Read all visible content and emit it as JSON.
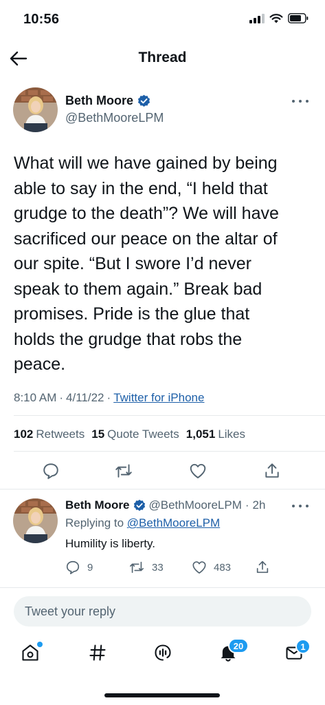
{
  "status_bar": {
    "time": "10:56"
  },
  "header": {
    "title": "Thread"
  },
  "main_tweet": {
    "name": "Beth Moore",
    "handle": "@BethMooreLPM",
    "text": "What will we have gained by being\nable to say in the end, “I held that\ngrudge to the death”? We will have\nsacrificed our peace on the altar of\nour spite. “But I swore I’d never\nspeak to them again.” Break bad\npromises. Pride is the glue that\nholds the grudge that robs the\npeace.",
    "time": "8:10 AM",
    "sep1": "·",
    "date": "4/11/22",
    "sep2": "·",
    "source": "Twitter for iPhone",
    "retweets_count": "102",
    "retweets_label": "Retweets",
    "quotes_count": "15",
    "quotes_label": "Quote Tweets",
    "likes_count": "1,051",
    "likes_label": "Likes"
  },
  "reply": {
    "name": "Beth Moore",
    "handle": "@BethMooreLPM",
    "sep": "·",
    "age": "2h",
    "replying_prefix": "Replying to",
    "replying_to": "@BethMooreLPM",
    "text": "Humility is liberty.",
    "reply_count": "9",
    "retweet_count": "33",
    "like_count": "483"
  },
  "compose": {
    "placeholder": "Tweet your reply"
  },
  "tab_bar": {
    "notifications_badge": "20",
    "messages_badge": "1"
  },
  "colors": {
    "accent": "#1d9bf0",
    "link": "#1d5fa8",
    "secondary_text": "#536471"
  }
}
